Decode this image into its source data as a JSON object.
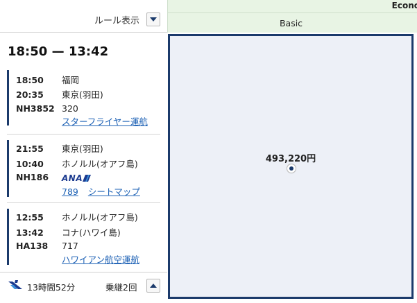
{
  "rules": {
    "label": "ルール表示"
  },
  "route": {
    "time_range": "18:50 — 13:42"
  },
  "segments": [
    {
      "dep_time": "18:50",
      "dep_airport": "福岡",
      "arr_time": "20:35",
      "arr_airport": "東京(羽田)",
      "flight_no": "NH3852",
      "aircraft": "320",
      "operator_link": "スターフライヤー運航"
    },
    {
      "dep_time": "21:55",
      "dep_airport": "東京(羽田)",
      "arr_time": "10:40",
      "arr_airport": "ホノルル(オアフ島)",
      "flight_no": "NH186",
      "airline_logo": "ANA",
      "aircraft_link": "789",
      "seatmap_link": "シートマップ"
    },
    {
      "dep_time": "12:55",
      "dep_airport": "ホノルル(オアフ島)",
      "arr_time": "13:42",
      "arr_airport": "コナ(ハワイ島)",
      "flight_no": "HA138",
      "aircraft": "717",
      "operator_link": "ハワイアン航空運航"
    }
  ],
  "footer": {
    "duration": "13時間52分",
    "transfers": "乗継2回"
  },
  "fare": {
    "class_header": "Econo",
    "fare_type": "Basic",
    "price": "493,220円"
  },
  "colors": {
    "navy": "#1b3a6b",
    "link": "#1a5fb4",
    "header_green": "#e8f4e4",
    "cell_bg": "#edf0f7"
  }
}
